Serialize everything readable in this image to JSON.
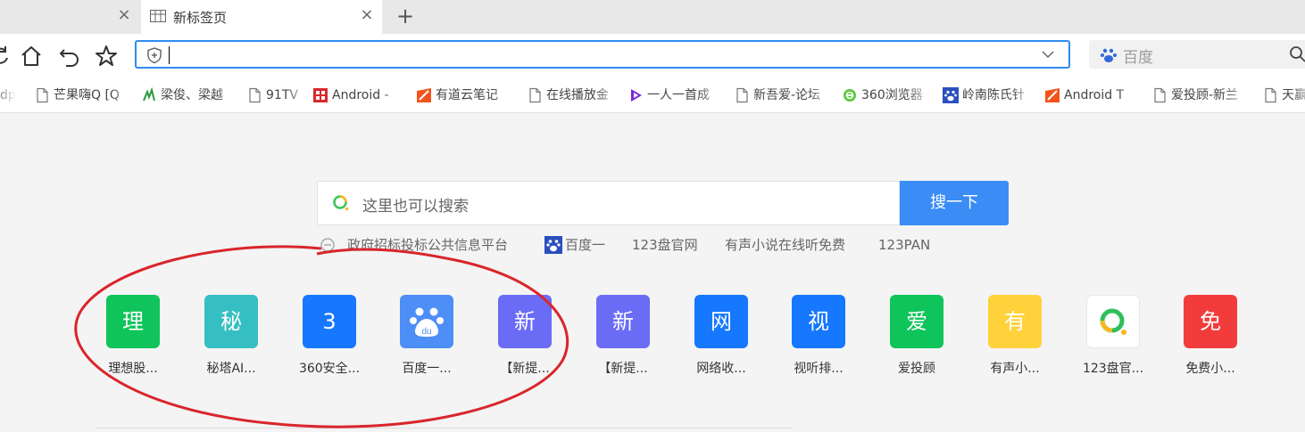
{
  "tabs": {
    "active_title": "新标签页",
    "new_tab_symbol": "+",
    "close_symbol": "×"
  },
  "toolbar": {
    "address_value": "",
    "search_engine": "百度"
  },
  "bookmarks": [
    {
      "label": "dp",
      "icon": "page-icon"
    },
    {
      "label": "芒果嗨Q [Q",
      "icon": "page-icon"
    },
    {
      "label": "梁俊、梁越",
      "icon": "leaf-icon"
    },
    {
      "label": "91TV",
      "icon": "page-icon"
    },
    {
      "label": "Android -",
      "icon": "red-grid-icon"
    },
    {
      "label": "有道云笔记",
      "icon": "youdao-icon"
    },
    {
      "label": "在线播放金",
      "icon": "page-icon"
    },
    {
      "label": "一人一首成",
      "icon": "play-icon"
    },
    {
      "label": "新吾爱-论坛",
      "icon": "page-icon"
    },
    {
      "label": "360浏览器",
      "icon": "360-icon"
    },
    {
      "label": "岭南陈氏针",
      "icon": "paw-icon"
    },
    {
      "label": "Android T",
      "icon": "youdao-icon"
    },
    {
      "label": "爱投顾-新兰",
      "icon": "page-icon"
    },
    {
      "label": "天赢",
      "icon": "page-icon"
    }
  ],
  "search": {
    "placeholder": "这里也可以搜索",
    "button_label": "搜一下"
  },
  "hot_links": [
    "政府招标投标公共信息平台",
    "百度一",
    "123盘官网",
    "有声小说在线听免费",
    "123PAN"
  ],
  "tiles": [
    {
      "glyph": "理",
      "label": "理想股...",
      "color": "#0fc45a"
    },
    {
      "glyph": "秘",
      "label": "秘塔AI...",
      "color": "#36bfc2"
    },
    {
      "glyph": "3",
      "label": "360安全...",
      "color": "#1677ff"
    },
    {
      "glyph": "",
      "label": "百度一...",
      "color": "#4e8ef7",
      "icon": "baidu-paw-icon"
    },
    {
      "glyph": "新",
      "label": "【新提...",
      "color": "#6b6cf5"
    },
    {
      "glyph": "新",
      "label": "【新提...",
      "color": "#6b6cf5"
    },
    {
      "glyph": "网",
      "label": "网络收...",
      "color": "#1677ff"
    },
    {
      "glyph": "视",
      "label": "视听排...",
      "color": "#1677ff"
    },
    {
      "glyph": "爱",
      "label": "爱投顾",
      "color": "#0fc45a"
    },
    {
      "glyph": "有",
      "label": "有声小...",
      "color": "#ffd23c"
    },
    {
      "glyph": "",
      "label": "123盘官...",
      "color": "#ffffff",
      "icon": "123pan-ring-icon"
    },
    {
      "glyph": "免",
      "label": "免费小...",
      "color": "#f23c3c"
    }
  ],
  "annotation": {
    "color": "#d9262b"
  }
}
